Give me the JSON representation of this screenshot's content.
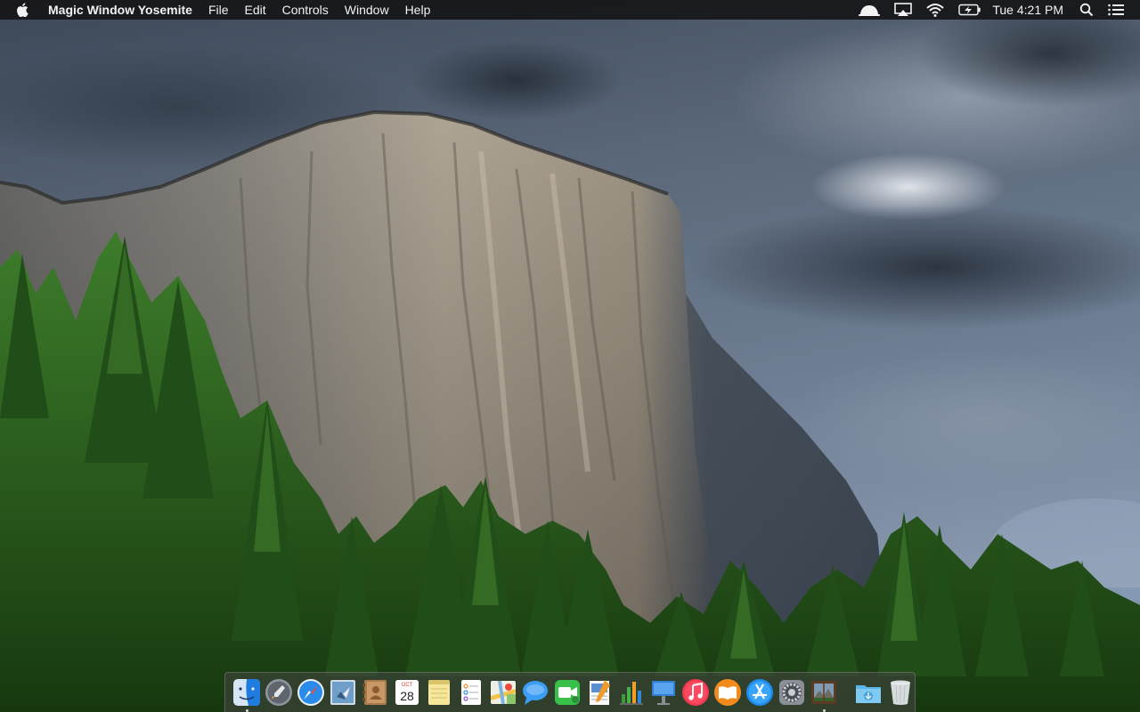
{
  "menubar": {
    "apple_icon": "apple-logo-icon",
    "app_name": "Magic Window Yosemite",
    "menus": [
      "File",
      "Edit",
      "Controls",
      "Window",
      "Help"
    ],
    "status_icons": [
      "notification-hat-icon",
      "airplay-icon",
      "wifi-icon",
      "battery-charging-icon"
    ],
    "clock": "Tue 4:21 PM",
    "spotlight_icon": "spotlight-search-icon",
    "notification_center_icon": "notification-center-icon"
  },
  "desktop": {
    "wallpaper": "Yosemite El Capitan cliff with pine forest under stormy sky"
  },
  "dock": {
    "apps": [
      {
        "name": "Finder",
        "icon": "finder-icon",
        "running": true
      },
      {
        "name": "Launchpad",
        "icon": "launchpad-icon",
        "running": false
      },
      {
        "name": "Safari",
        "icon": "safari-icon",
        "running": false
      },
      {
        "name": "Mail",
        "icon": "mail-icon",
        "running": false
      },
      {
        "name": "Contacts",
        "icon": "contacts-icon",
        "running": false
      },
      {
        "name": "Calendar",
        "icon": "calendar-icon",
        "running": false,
        "month": "OCT",
        "day": "28"
      },
      {
        "name": "Notes",
        "icon": "notes-icon",
        "running": false
      },
      {
        "name": "Reminders",
        "icon": "reminders-icon",
        "running": false
      },
      {
        "name": "Maps",
        "icon": "maps-icon",
        "running": false
      },
      {
        "name": "Messages",
        "icon": "messages-icon",
        "running": false
      },
      {
        "name": "FaceTime",
        "icon": "facetime-icon",
        "running": false
      },
      {
        "name": "Pages",
        "icon": "pages-icon",
        "running": false
      },
      {
        "name": "Numbers",
        "icon": "numbers-icon",
        "running": false
      },
      {
        "name": "Keynote",
        "icon": "keynote-icon",
        "running": false
      },
      {
        "name": "iTunes",
        "icon": "itunes-icon",
        "running": false
      },
      {
        "name": "iBooks",
        "icon": "ibooks-icon",
        "running": false
      },
      {
        "name": "App Store",
        "icon": "app-store-icon",
        "running": false
      },
      {
        "name": "System Preferences",
        "icon": "system-preferences-icon",
        "running": false
      },
      {
        "name": "Magic Window",
        "icon": "magic-window-icon",
        "running": true
      }
    ],
    "stacks": [
      {
        "name": "Downloads",
        "icon": "downloads-folder-icon"
      },
      {
        "name": "Trash",
        "icon": "trash-icon"
      }
    ]
  },
  "colors": {
    "menubar_bg": "#161618",
    "menubar_text": "#f2f2f2",
    "sky_dark": "#2e3a49",
    "sky_light": "#8a97a8",
    "rock": "#a59c8f",
    "forest": "#2f6a24"
  }
}
